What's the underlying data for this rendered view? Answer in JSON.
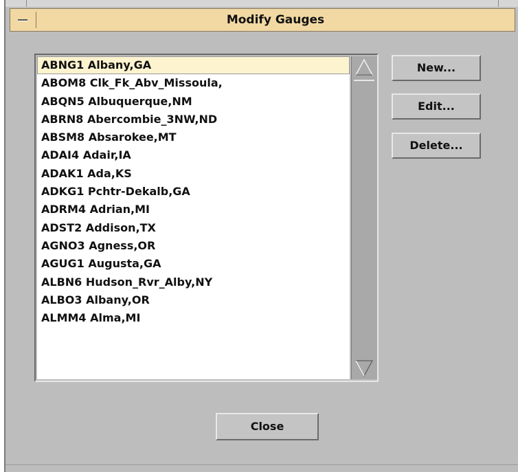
{
  "window": {
    "title": "Modify Gauges"
  },
  "gauges": {
    "items": [
      "ABNG1 Albany,GA",
      "ABOM8 Clk_Fk_Abv_Missoula,",
      "ABQN5 Albuquerque,NM",
      "ABRN8 Abercombie_3NW,ND",
      "ABSM8 Absarokee,MT",
      "ADAI4 Adair,IA",
      "ADAK1 Ada,KS",
      "ADKG1 Pchtr-Dekalb,GA",
      "ADRM4 Adrian,MI",
      "ADST2 Addison,TX",
      "AGNO3 Agness,OR",
      "AGUG1 Augusta,GA",
      "ALBN6 Hudson_Rvr_Alby,NY",
      "ALBO3 Albany,OR",
      "ALMM4 Alma,MI"
    ],
    "selected_index": 0
  },
  "buttons": {
    "new_label": "New...",
    "edit_label": "Edit...",
    "delete_label": "Delete...",
    "close_label": "Close"
  },
  "icons": {
    "window_menu": "window-menu-icon",
    "scroll_up": "scroll-up-arrow-icon",
    "scroll_down": "scroll-down-arrow-icon"
  },
  "colors": {
    "titlebar": "#f2d9a3",
    "background": "#bdbdbd",
    "selection": "#fdf3cf"
  }
}
